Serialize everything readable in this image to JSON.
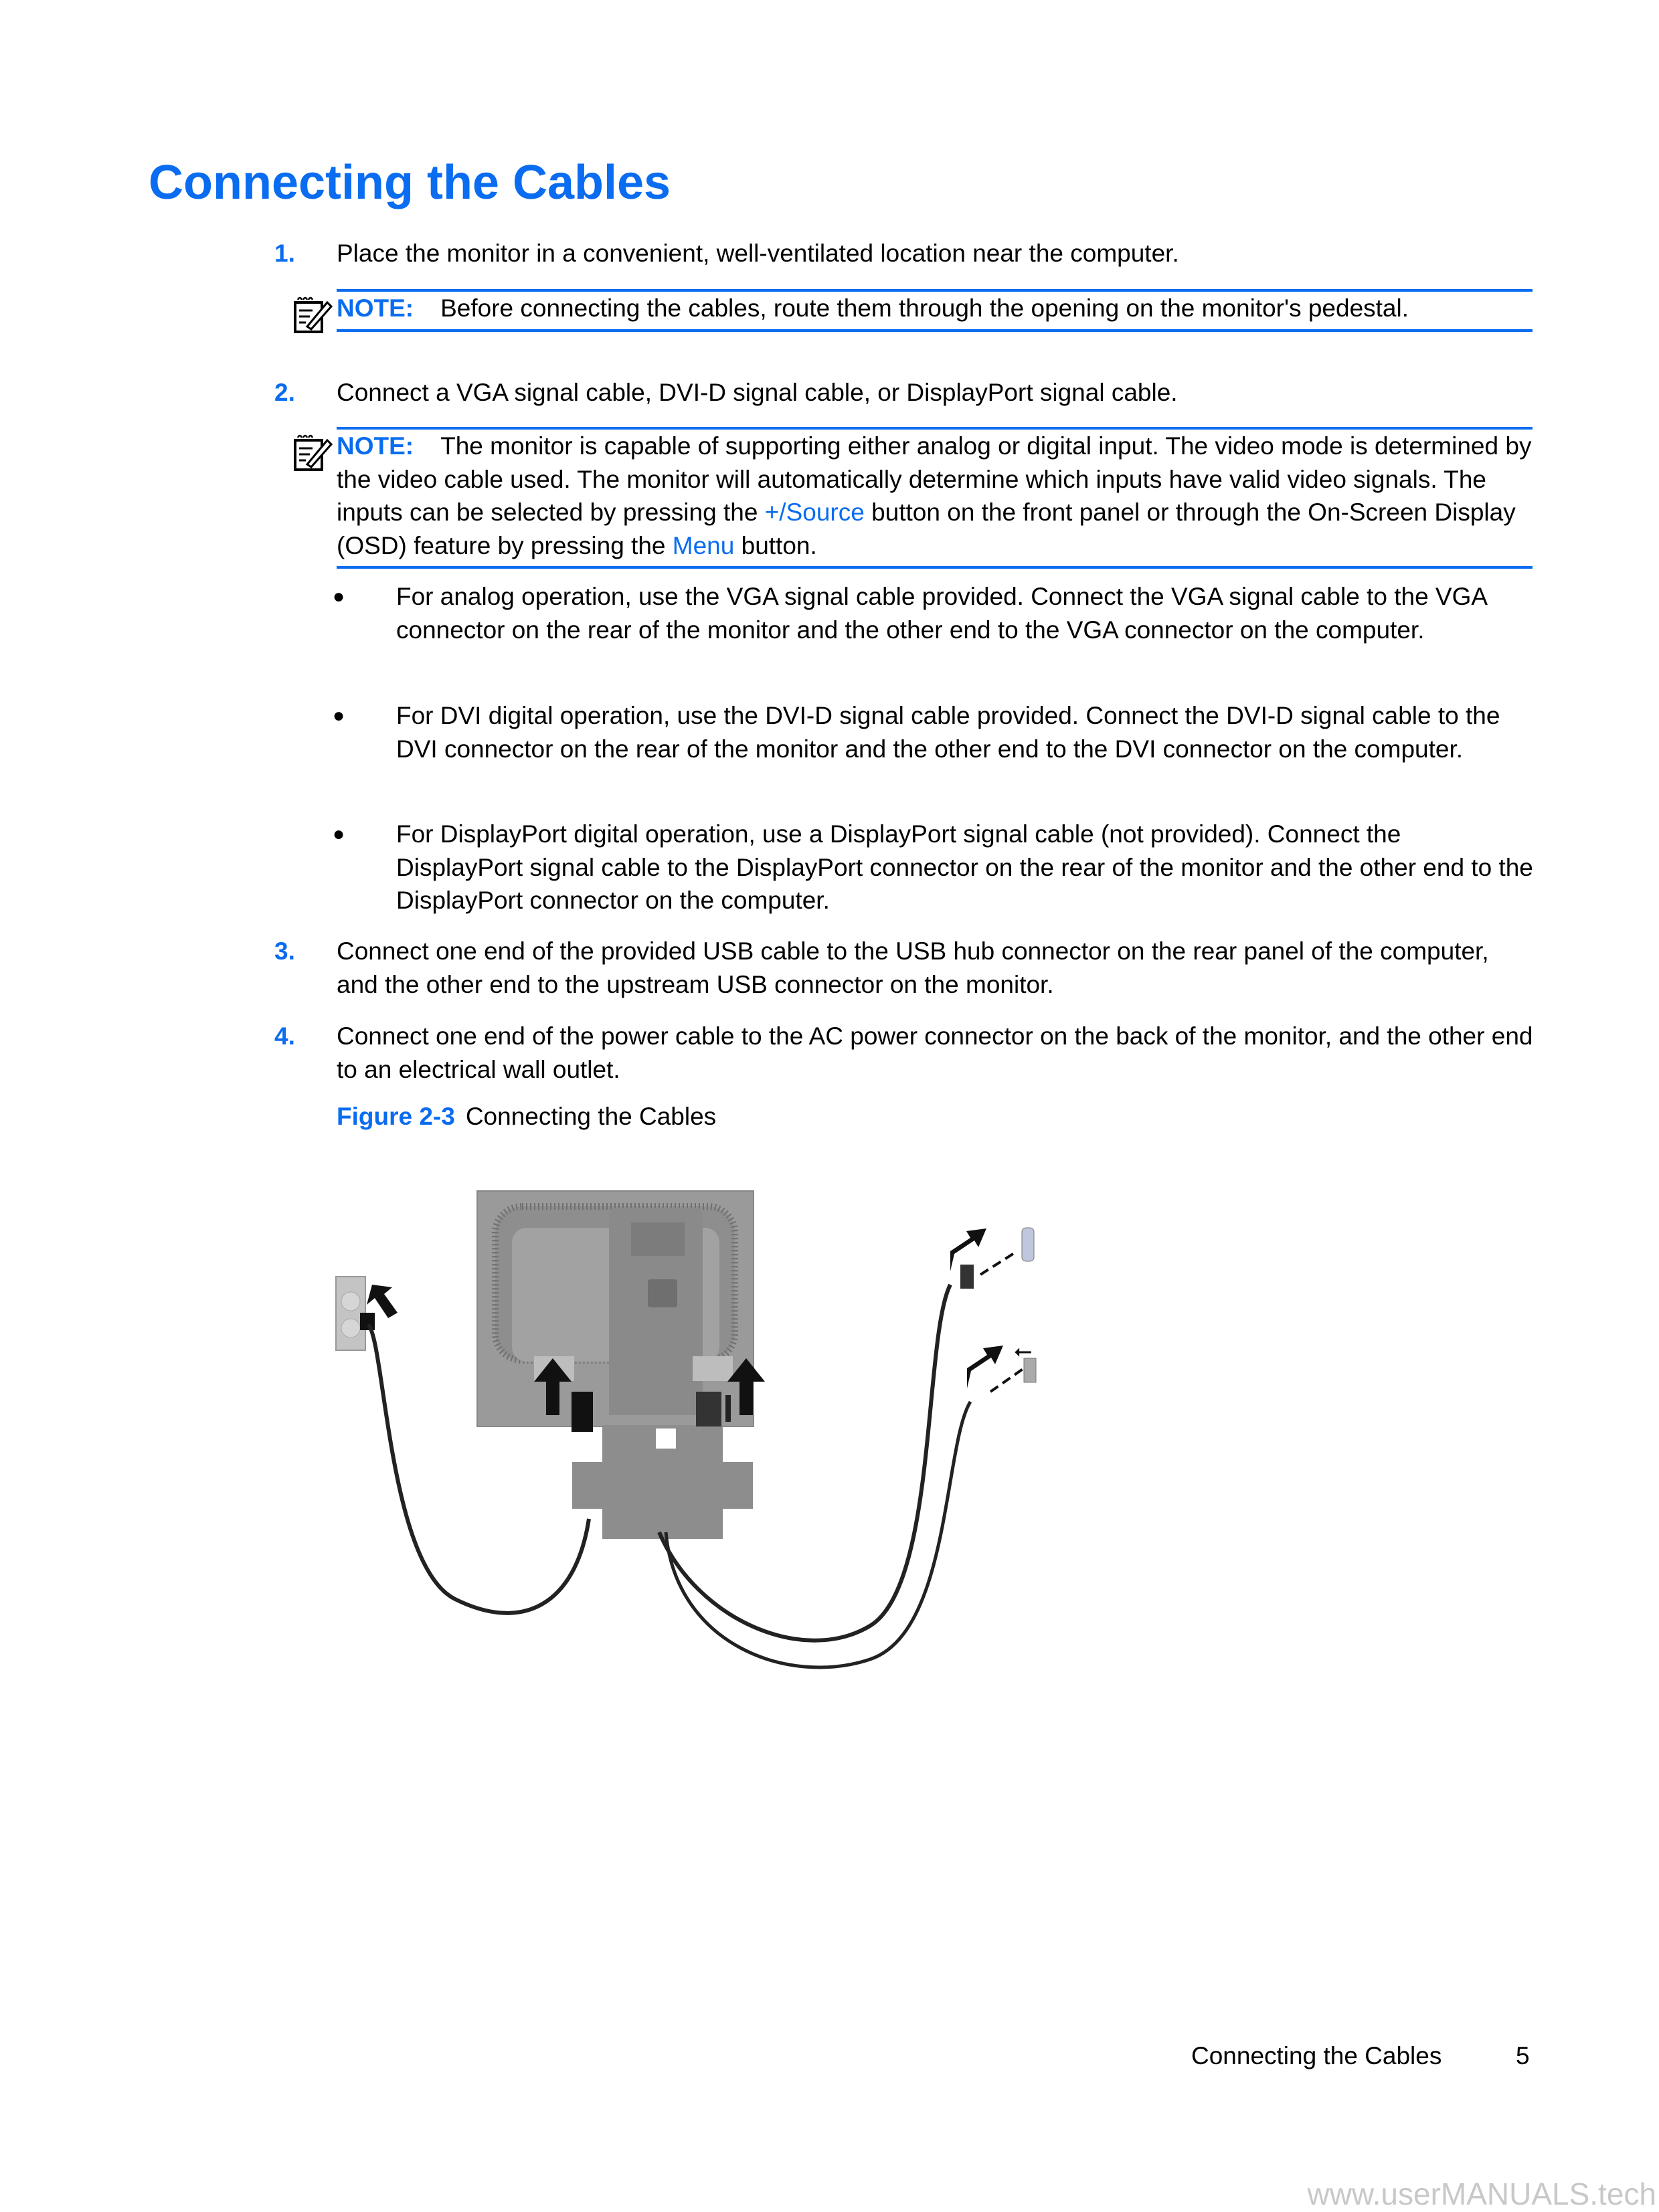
{
  "heading": "Connecting the Cables",
  "colors": {
    "accent": "#0a6cf0",
    "text": "#000000",
    "watermark": "#c8c8c8"
  },
  "steps": [
    {
      "number": "1.",
      "text": "Place the monitor in a convenient, well-ventilated location near the computer."
    },
    {
      "number": "2.",
      "text": "Connect a VGA signal cable, DVI-D signal cable, or DisplayPort signal cable."
    },
    {
      "number": "3.",
      "text": "Connect one end of the provided USB cable to the USB hub connector on the rear panel of the computer, and the other end to the upstream USB connector on the monitor."
    },
    {
      "number": "4.",
      "text": "Connect one end of the power cable to the AC power connector on the back of the monitor, and the other end to an electrical wall outlet."
    }
  ],
  "notes": [
    {
      "icon": "note-pad-pencil-icon",
      "label": "NOTE:",
      "text": "Before connecting the cables, route them through the opening on the monitor's pedestal."
    },
    {
      "icon": "note-pad-pencil-icon",
      "label": "NOTE:",
      "text_before_source": "The monitor is capable of supporting either analog or digital input. The video mode is determined by the video cable used. The monitor will automatically determine which inputs have valid video signals. The inputs can be selected by pressing the ",
      "source_button": "+/Source",
      "text_after_source": " button on the front panel or through the On-Screen Display (OSD) feature by pressing the ",
      "menu_button": "Menu",
      "text_end": " button."
    }
  ],
  "bullets": [
    {
      "symbol": "●",
      "text": "For analog operation, use the VGA signal cable provided. Connect the VGA signal cable to the VGA connector on the rear of the monitor and the other end to the VGA connector on the computer."
    },
    {
      "symbol": "●",
      "text": "For DVI digital operation, use the DVI-D signal cable provided. Connect the DVI-D signal cable to the DVI connector on the rear of the monitor and the other end to the DVI connector on the computer."
    },
    {
      "symbol": "●",
      "text": "For DisplayPort digital operation, use a DisplayPort signal cable (not provided). Connect the DisplayPort signal cable to the DisplayPort connector on the rear of the monitor and the other end to the DisplayPort connector on the computer."
    }
  ],
  "figure": {
    "label": "Figure 2-3",
    "caption": "Connecting the Cables",
    "image_description": "Rear view of monitor on pedestal with power, VGA/DVI and USB cables connected to wall outlet and computer"
  },
  "footer": {
    "section": "Connecting the Cables",
    "page": "5"
  },
  "watermark": "www.userMANUALS.tech"
}
